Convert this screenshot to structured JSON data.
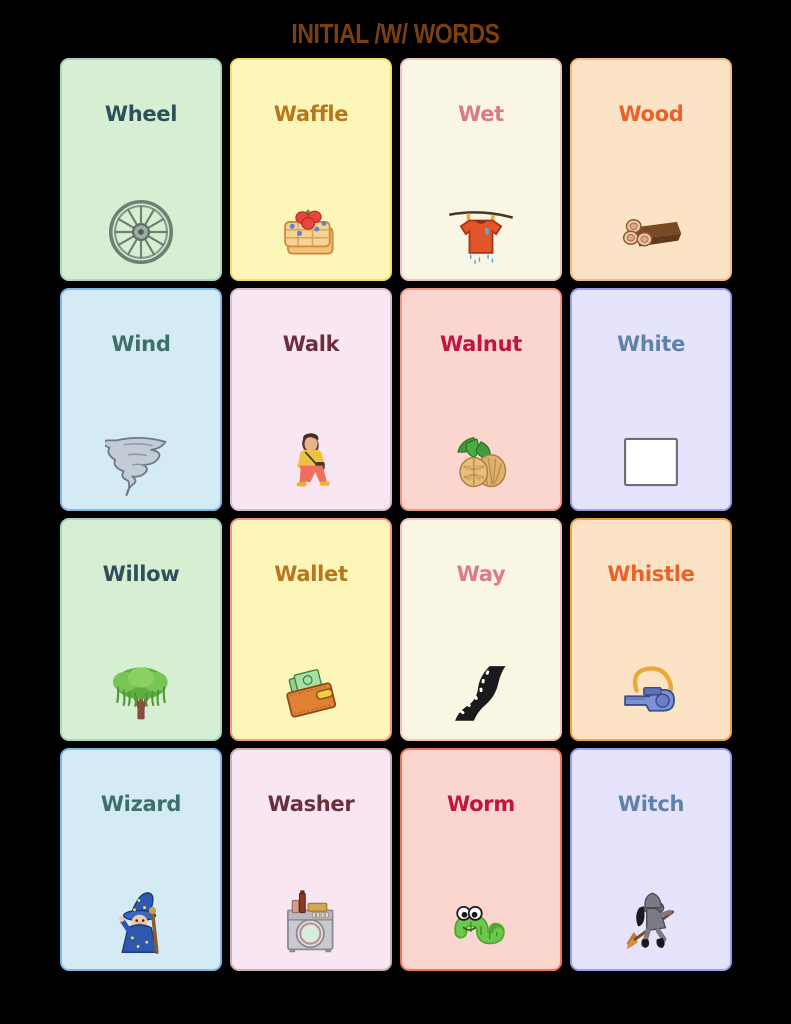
{
  "title": "INITIAL /W/ WORDS",
  "title_color": "#7B3F10",
  "background_color": "#000000",
  "grid": {
    "columns": 4,
    "rows": 4
  },
  "cards": [
    {
      "label": "Wheel",
      "icon": "wagon-wheel-icon",
      "bg": "#D6EFD2",
      "border": "#A8D5C4",
      "text": "#2F4F5A"
    },
    {
      "label": "Waffle",
      "icon": "waffle-icon",
      "bg": "#FCF7B8",
      "border": "#F6DE6A",
      "text": "#B8761F"
    },
    {
      "label": "Wet",
      "icon": "wet-shirt-icon",
      "bg": "#FAF6E4",
      "border": "#F3C2C0",
      "text": "#DB7B8A"
    },
    {
      "label": "Wood",
      "icon": "wood-logs-icon",
      "bg": "#FCE3C6",
      "border": "#F3BC7E",
      "text": "#E8622A"
    },
    {
      "label": "Wind",
      "icon": "tornado-icon",
      "bg": "#D4EBF6",
      "border": "#7EB8E8",
      "text": "#3D7068"
    },
    {
      "label": "Walk",
      "icon": "walking-person-icon",
      "bg": "#F8E6F2",
      "border": "#D9BDCB",
      "text": "#6B2E3E"
    },
    {
      "label": "Walnut",
      "icon": "walnut-icon",
      "bg": "#FBD6CE",
      "border": "#F59585",
      "text": "#C21343"
    },
    {
      "label": "White",
      "icon": "white-square-icon",
      "bg": "#E6E4FC",
      "border": "#9D9CF0",
      "text": "#6182A8"
    },
    {
      "label": "Willow",
      "icon": "willow-tree-icon",
      "bg": "#D6EFD2",
      "border": "#A8D5C4",
      "text": "#2F4F5A"
    },
    {
      "label": "Wallet",
      "icon": "wallet-icon",
      "bg": "#FCF7B8",
      "border": "#F59585",
      "text": "#B8761F"
    },
    {
      "label": "Way",
      "icon": "road-icon",
      "bg": "#FAF6E4",
      "border": "#F3C2C0",
      "text": "#DB7B8A"
    },
    {
      "label": "Whistle",
      "icon": "whistle-icon",
      "bg": "#FCE3C6",
      "border": "#F3A13C",
      "text": "#E8622A"
    },
    {
      "label": "Wizard",
      "icon": "wizard-icon",
      "bg": "#D4EBF6",
      "border": "#7EB8E8",
      "text": "#3D7068"
    },
    {
      "label": "Washer",
      "icon": "washing-machine-icon",
      "bg": "#F8E6F2",
      "border": "#C9B0B6",
      "text": "#6B2E3E"
    },
    {
      "label": "Worm",
      "icon": "worm-icon",
      "bg": "#FBD6CE",
      "border": "#F5705A",
      "text": "#C21343"
    },
    {
      "label": "Witch",
      "icon": "witch-icon",
      "bg": "#E6E4FC",
      "border": "#9D9CF0",
      "text": "#6182A8"
    }
  ]
}
